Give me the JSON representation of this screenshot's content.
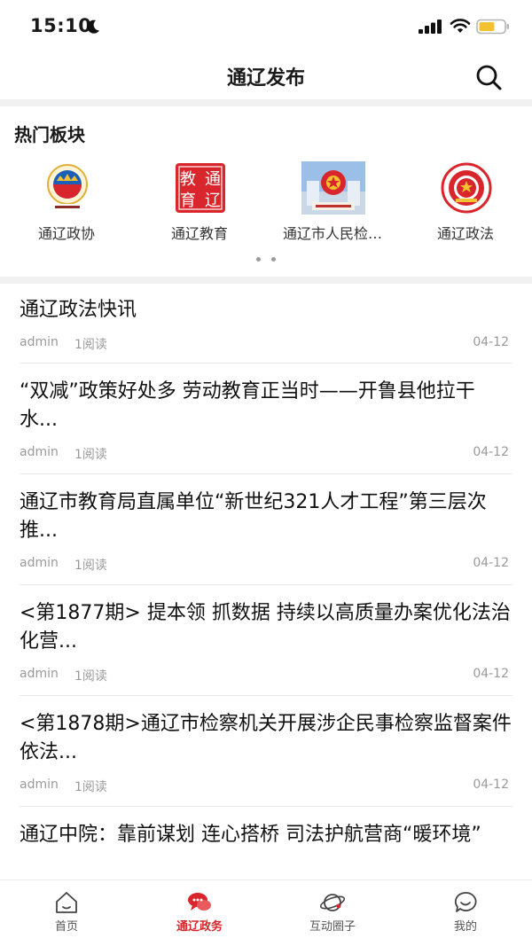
{
  "status_bar": {
    "time": "15:10"
  },
  "nav": {
    "title": "通辽发布"
  },
  "hot": {
    "heading": "热门板块",
    "items": [
      {
        "label": "通辽政协",
        "icon": "cppcc-emblem-icon"
      },
      {
        "label": "通辽教育",
        "icon": "education-seal-icon",
        "seal_text": [
          "教",
          "通",
          "育",
          "辽"
        ]
      },
      {
        "label": "通辽市人民检…",
        "icon": "procuratorate-emblem-icon"
      },
      {
        "label": "通辽政法",
        "icon": "political-legal-emblem-icon"
      }
    ]
  },
  "news": [
    {
      "title": "通辽政法快讯",
      "author": "admin",
      "reads": "1阅读",
      "date": "04-12"
    },
    {
      "title": "“双减”政策好处多 劳动教育正当时——开鲁县他拉干水...",
      "author": "admin",
      "reads": "1阅读",
      "date": "04-12"
    },
    {
      "title": "通辽市教育局直属单位“新世纪321人才工程”第三层次推...",
      "author": "admin",
      "reads": "1阅读",
      "date": "04-12"
    },
    {
      "title": "<第1877期> 提本领 抓数据 持续以高质量办案优化法治化营...",
      "author": "admin",
      "reads": "1阅读",
      "date": "04-12"
    },
    {
      "title": "<第1878期>通辽市检察机关开展涉企民事检察监督案件依法...",
      "author": "admin",
      "reads": "1阅读",
      "date": "04-12"
    },
    {
      "title": "通辽中院：靠前谋划 连心搭桥 司法护航营商“暖环境”",
      "author": "",
      "reads": "",
      "date": ""
    }
  ],
  "tabs": [
    {
      "label": "首页",
      "icon": "home-icon",
      "active": false
    },
    {
      "label": "通辽政务",
      "icon": "chat-bubbles-icon",
      "active": true
    },
    {
      "label": "互动圈子",
      "icon": "planet-icon",
      "active": false
    },
    {
      "label": "我的",
      "icon": "smile-bubble-icon",
      "active": false
    }
  ],
  "colors": {
    "accent": "#d8262c",
    "divider": "#f1f1f1",
    "meta": "#9a9a9a"
  }
}
